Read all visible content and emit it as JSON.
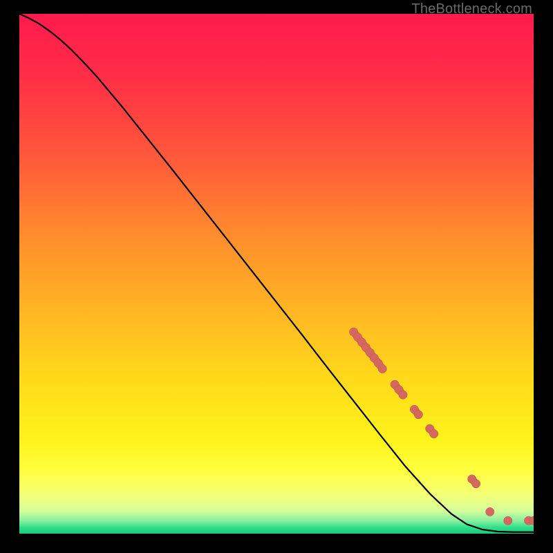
{
  "watermark": "TheBottleneck.com",
  "colors": {
    "gradient_stops": [
      {
        "offset": 0.0,
        "color": "#ff1a4d"
      },
      {
        "offset": 0.12,
        "color": "#ff2e47"
      },
      {
        "offset": 0.28,
        "color": "#ff5a3a"
      },
      {
        "offset": 0.42,
        "color": "#ff8a2e"
      },
      {
        "offset": 0.56,
        "color": "#ffb224"
      },
      {
        "offset": 0.7,
        "color": "#ffd91a"
      },
      {
        "offset": 0.82,
        "color": "#fff31a"
      },
      {
        "offset": 0.88,
        "color": "#ffff40"
      },
      {
        "offset": 0.92,
        "color": "#f6ff70"
      },
      {
        "offset": 0.955,
        "color": "#d8ff9a"
      },
      {
        "offset": 0.975,
        "color": "#8af0a0"
      },
      {
        "offset": 0.988,
        "color": "#2fe08a"
      },
      {
        "offset": 1.0,
        "color": "#19c97a"
      }
    ],
    "curve": "#000000",
    "marker_fill": "#d4685f",
    "marker_stroke": "#c25a52"
  },
  "chart_data": {
    "type": "line",
    "title": "",
    "xlabel": "",
    "ylabel": "",
    "xlim": [
      0,
      100
    ],
    "ylim": [
      0,
      100
    ],
    "curve": [
      {
        "x": 0,
        "y": 100.0
      },
      {
        "x": 2,
        "y": 99.1
      },
      {
        "x": 4,
        "y": 98.0
      },
      {
        "x": 6,
        "y": 96.6
      },
      {
        "x": 8,
        "y": 95.0
      },
      {
        "x": 10,
        "y": 93.2
      },
      {
        "x": 12,
        "y": 91.2
      },
      {
        "x": 15,
        "y": 88.0
      },
      {
        "x": 20,
        "y": 82.1
      },
      {
        "x": 25,
        "y": 75.9
      },
      {
        "x": 30,
        "y": 69.7
      },
      {
        "x": 35,
        "y": 63.4
      },
      {
        "x": 40,
        "y": 57.1
      },
      {
        "x": 45,
        "y": 50.8
      },
      {
        "x": 50,
        "y": 44.5
      },
      {
        "x": 55,
        "y": 38.2
      },
      {
        "x": 60,
        "y": 31.8
      },
      {
        "x": 65,
        "y": 25.5
      },
      {
        "x": 70,
        "y": 19.2
      },
      {
        "x": 75,
        "y": 13.0
      },
      {
        "x": 80,
        "y": 7.5
      },
      {
        "x": 84,
        "y": 3.8
      },
      {
        "x": 87,
        "y": 1.8
      },
      {
        "x": 90,
        "y": 0.8
      },
      {
        "x": 93,
        "y": 0.4
      },
      {
        "x": 96,
        "y": 0.3
      },
      {
        "x": 100,
        "y": 0.3
      }
    ],
    "markers": [
      {
        "x": 65.0,
        "y": 38.8
      },
      {
        "x": 65.8,
        "y": 37.8
      },
      {
        "x": 66.6,
        "y": 36.8
      },
      {
        "x": 67.4,
        "y": 35.8
      },
      {
        "x": 68.2,
        "y": 34.8
      },
      {
        "x": 69.0,
        "y": 33.8
      },
      {
        "x": 69.8,
        "y": 32.8
      },
      {
        "x": 70.6,
        "y": 31.7
      },
      {
        "x": 73.0,
        "y": 28.7
      },
      {
        "x": 73.8,
        "y": 27.7
      },
      {
        "x": 74.6,
        "y": 26.7
      },
      {
        "x": 76.8,
        "y": 23.9
      },
      {
        "x": 77.6,
        "y": 22.9
      },
      {
        "x": 79.8,
        "y": 20.2
      },
      {
        "x": 80.6,
        "y": 19.2
      },
      {
        "x": 88.0,
        "y": 10.5
      },
      {
        "x": 88.8,
        "y": 9.6
      },
      {
        "x": 91.5,
        "y": 4.2
      },
      {
        "x": 95.0,
        "y": 2.5
      },
      {
        "x": 99.0,
        "y": 2.5
      },
      {
        "x": 100.0,
        "y": 2.5
      }
    ],
    "marker_connect_pairs": [
      [
        0,
        1
      ],
      [
        1,
        2
      ],
      [
        2,
        3
      ],
      [
        3,
        4
      ],
      [
        4,
        5
      ],
      [
        5,
        6
      ],
      [
        6,
        7
      ],
      [
        8,
        9
      ],
      [
        9,
        10
      ],
      [
        11,
        12
      ],
      [
        13,
        14
      ],
      [
        15,
        16
      ],
      [
        19,
        20
      ]
    ]
  }
}
